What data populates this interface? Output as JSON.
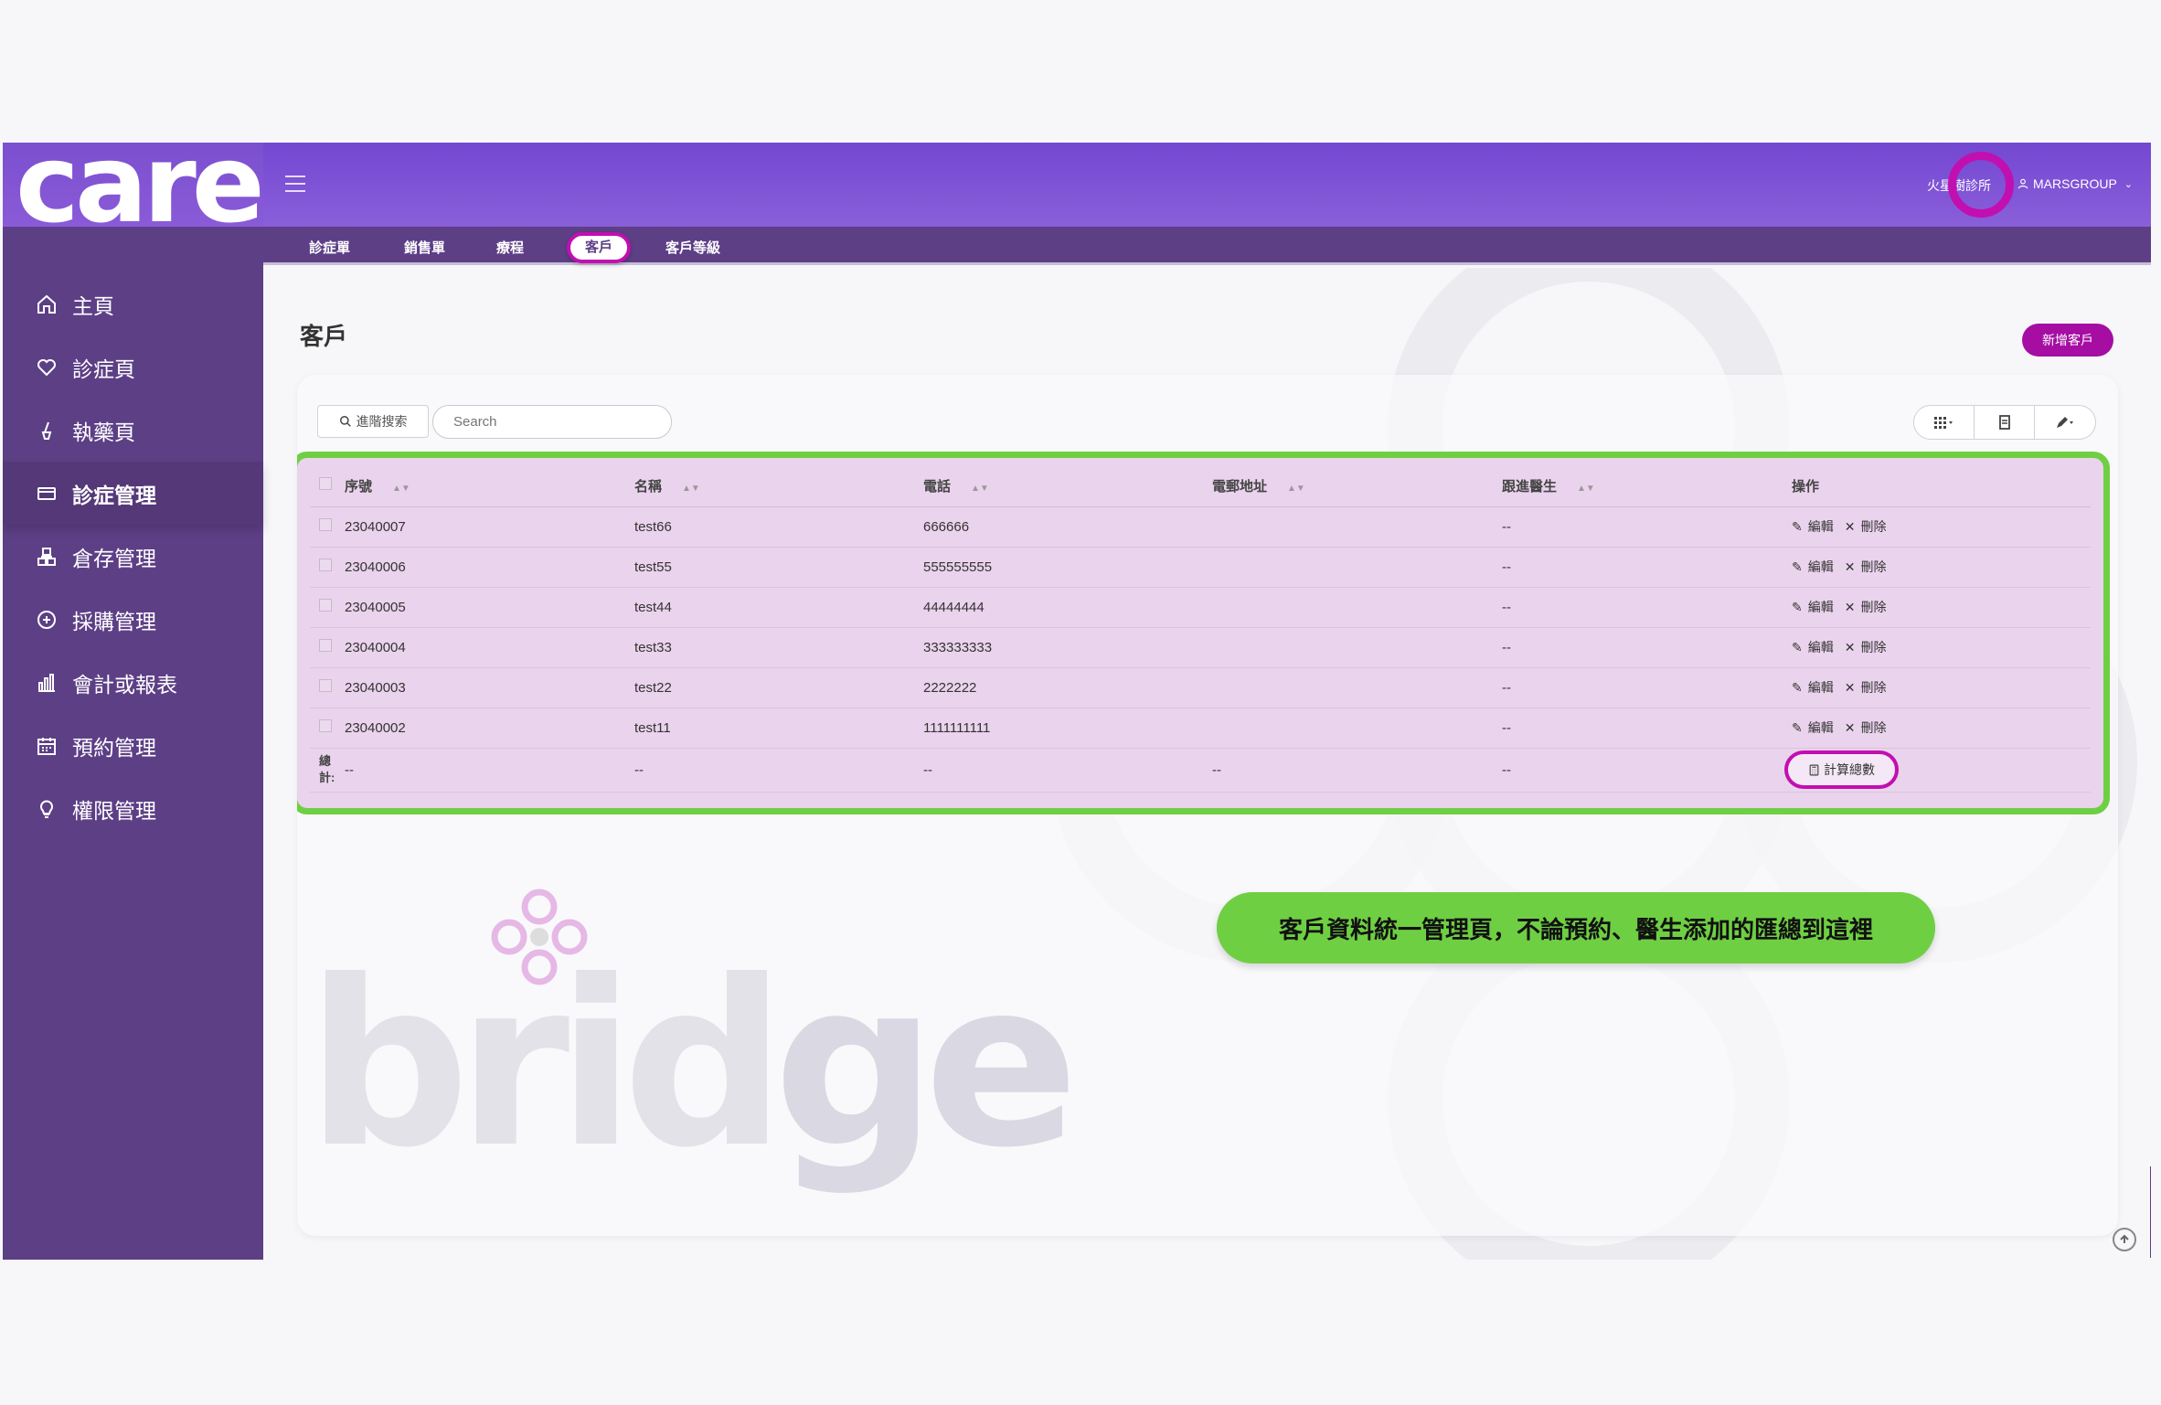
{
  "app": {
    "logo_text": "care",
    "watermark_text_a": "brid",
    "watermark_text_b": "ge"
  },
  "sidebar": {
    "items": [
      {
        "label": "主頁",
        "icon": "home-icon"
      },
      {
        "label": "診症頁",
        "icon": "heart-icon"
      },
      {
        "label": "執藥頁",
        "icon": "mortar-icon"
      },
      {
        "label": "診症管理",
        "icon": "card-icon"
      },
      {
        "label": "倉存管理",
        "icon": "boxes-icon"
      },
      {
        "label": "採購管理",
        "icon": "plus-circle-icon"
      },
      {
        "label": "會計或報表",
        "icon": "bar-chart-icon"
      },
      {
        "label": "預約管理",
        "icon": "calendar-icon"
      },
      {
        "label": "權限管理",
        "icon": "bulb-icon"
      }
    ],
    "active_index": 3
  },
  "topbar": {
    "clinic": "火星樹診所",
    "user": "MARSGROUP"
  },
  "subnav": {
    "tabs": [
      "診症單",
      "銷售單",
      "療程",
      "客戶",
      "客戶等級"
    ],
    "active": "客戶"
  },
  "page": {
    "title": "客戶",
    "add_button": "新增客戶"
  },
  "toolbar": {
    "advanced_search": "進階搜索",
    "search_placeholder": "Search"
  },
  "table": {
    "headers": [
      "序號",
      "名稱",
      "電話",
      "電郵地址",
      "跟進醫生",
      "操作"
    ],
    "rows": [
      {
        "id": "23040007",
        "name": "test66",
        "phone": "666666",
        "email": "",
        "doctor": "--"
      },
      {
        "id": "23040006",
        "name": "test55",
        "phone": "555555555",
        "email": "",
        "doctor": "--"
      },
      {
        "id": "23040005",
        "name": "test44",
        "phone": "44444444",
        "email": "",
        "doctor": "--"
      },
      {
        "id": "23040004",
        "name": "test33",
        "phone": "333333333",
        "email": "",
        "doctor": "--"
      },
      {
        "id": "23040003",
        "name": "test22",
        "phone": "2222222",
        "email": "",
        "doctor": "--"
      },
      {
        "id": "23040002",
        "name": "test11",
        "phone": "1111111111",
        "email": "",
        "doctor": "--"
      }
    ],
    "edit_label": "編輯",
    "delete_label": "刪除",
    "total": {
      "label_a": "總",
      "label_b": "計:",
      "id": "--",
      "name": "--",
      "phone": "--",
      "email": "--",
      "doctor": "--"
    },
    "calc_button": "計算總數"
  },
  "callout": "客戶資料統一管理頁，不論預約、醫生添加的匯總到這裡",
  "colors": {
    "sidebar": "#5d3f86",
    "accent": "#a50da3",
    "highlight_ring": "#c20fb0",
    "callout_green": "#6fcf43",
    "table_bg": "#ead3ec"
  }
}
